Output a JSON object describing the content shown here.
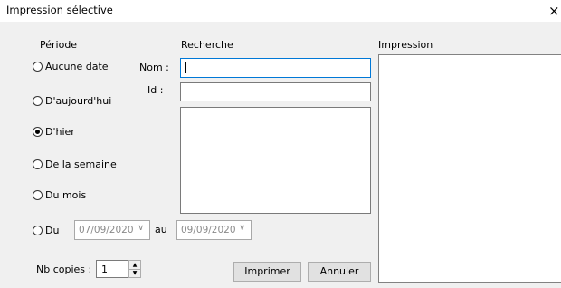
{
  "window": {
    "title": "Impression sélective",
    "close_glyph": "×"
  },
  "periode": {
    "header": "Période",
    "options": [
      {
        "label": "Aucune date",
        "selected": false
      },
      {
        "label": "D'aujourd'hui",
        "selected": false
      },
      {
        "label": "D'hier",
        "selected": true
      },
      {
        "label": "De la semaine",
        "selected": false
      },
      {
        "label": "Du mois",
        "selected": false
      },
      {
        "label": "Du",
        "selected": false
      }
    ],
    "date_from": "07/09/2020",
    "date_sep": "au",
    "date_to": "09/09/2020",
    "dropdown_glyph": "∨"
  },
  "recherche": {
    "header": "Recherche",
    "nom_label": "Nom :",
    "nom_value": "",
    "id_label": "Id :",
    "id_value": ""
  },
  "impression": {
    "header": "Impression"
  },
  "copies": {
    "label": "Nb copies :",
    "value": "1"
  },
  "buttons": {
    "print": "Imprimer",
    "cancel": "Annuler"
  },
  "icons": {
    "close": "close-icon",
    "spin_up": "spin-up-icon",
    "spin_down": "spin-down-icon",
    "dropdown": "chevron-down-icon"
  }
}
